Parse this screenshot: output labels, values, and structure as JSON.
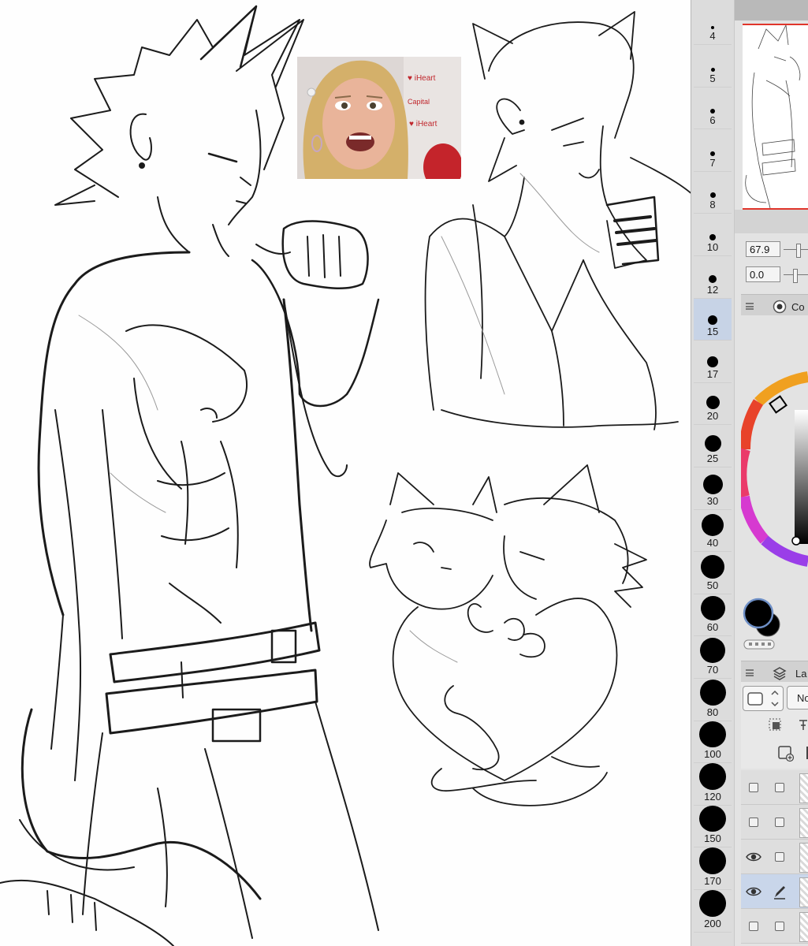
{
  "brush_sizes": [
    {
      "label": "4",
      "dot": 4
    },
    {
      "label": "5",
      "dot": 5
    },
    {
      "label": "6",
      "dot": 6
    },
    {
      "label": "7",
      "dot": 6
    },
    {
      "label": "8",
      "dot": 7
    },
    {
      "label": "10",
      "dot": 8
    },
    {
      "label": "12",
      "dot": 10
    },
    {
      "label": "15",
      "dot": 12,
      "selected": true
    },
    {
      "label": "17",
      "dot": 14
    },
    {
      "label": "20",
      "dot": 17
    },
    {
      "label": "25",
      "dot": 21
    },
    {
      "label": "30",
      "dot": 25
    },
    {
      "label": "40",
      "dot": 28
    },
    {
      "label": "50",
      "dot": 30
    },
    {
      "label": "60",
      "dot": 31
    },
    {
      "label": "70",
      "dot": 32
    },
    {
      "label": "80",
      "dot": 33
    },
    {
      "label": "100",
      "dot": 34
    },
    {
      "label": "120",
      "dot": 34
    },
    {
      "label": "150",
      "dot": 34
    },
    {
      "label": "170",
      "dot": 34
    },
    {
      "label": "200",
      "dot": 34
    }
  ],
  "navigator": {
    "rotate_value": "67.9",
    "angle_value": "0.0"
  },
  "color_palette": {
    "tab_label": "Co",
    "main_color": "#000000",
    "sub_color": "#000000",
    "wheel_marker_color": "#e8432a"
  },
  "layer_palette": {
    "tab_label": "La",
    "blend_mode": "No",
    "layers": [
      {
        "visible": false,
        "editing": false
      },
      {
        "visible": false,
        "editing": false
      },
      {
        "visible": true,
        "editing": false
      },
      {
        "visible": true,
        "editing": true,
        "active": true
      },
      {
        "visible": false,
        "editing": false
      }
    ]
  },
  "icons": {
    "eye": "eye-icon",
    "pen": "pen-icon",
    "layers": "layers-icon",
    "palette_circle": "color-circle-icon"
  },
  "colors": {
    "accent_selection": "#c7d3e6",
    "navigator_frame": "#e0352b",
    "panel_bg": "#e3e3e3"
  }
}
